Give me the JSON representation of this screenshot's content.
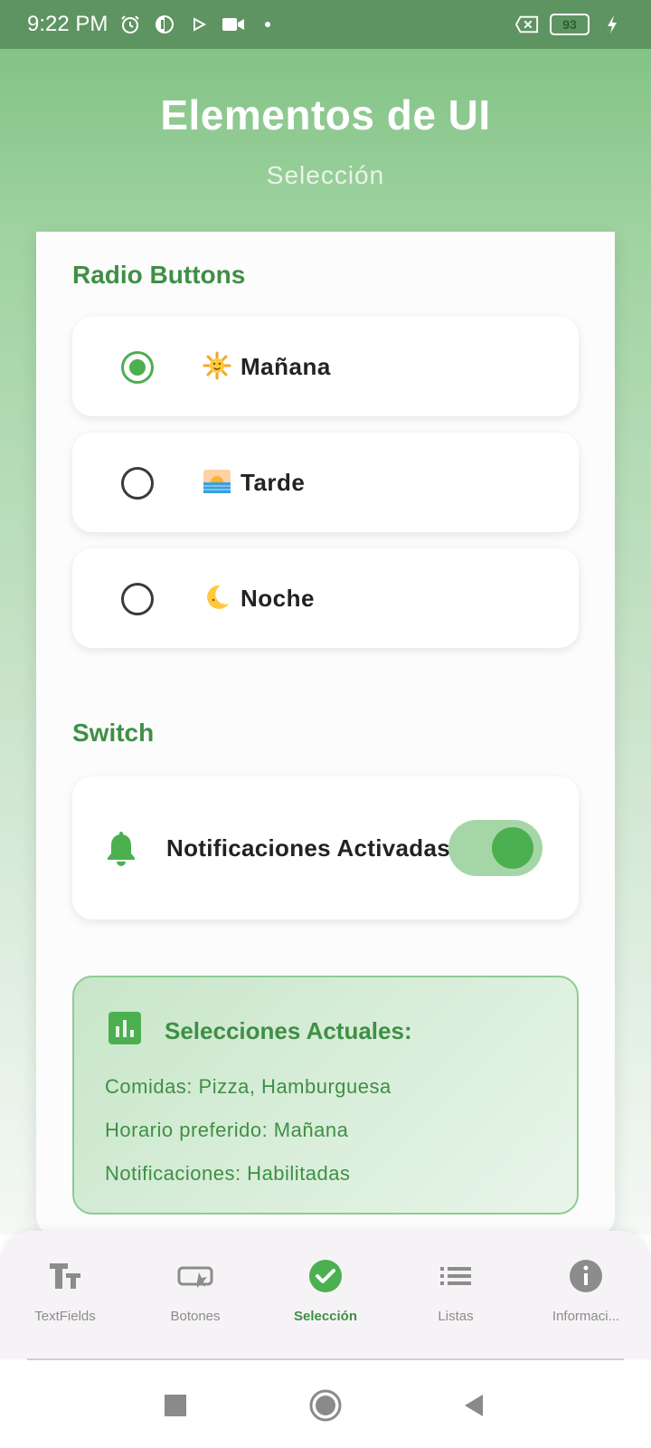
{
  "status_bar": {
    "time": "9:22 PM",
    "battery_level": "93",
    "icons": [
      "alarm-icon",
      "app-icon",
      "play-store-icon",
      "video-icon",
      "dot-icon",
      "no-sim-icon",
      "battery-icon",
      "charging-icon"
    ]
  },
  "header": {
    "title": "Elementos de UI",
    "subtitle": "Selección"
  },
  "radio_section": {
    "title": "Radio Buttons",
    "options": [
      {
        "label": "Mañana",
        "selected": true,
        "icon": "sun-icon"
      },
      {
        "label": "Tarde",
        "selected": false,
        "icon": "sunrise-icon"
      },
      {
        "label": "Noche",
        "selected": false,
        "icon": "crescent-moon-icon"
      }
    ]
  },
  "switch_section": {
    "title": "Switch",
    "label": "Notificaciones Activadas",
    "on": true
  },
  "summary": {
    "title": "Selecciones Actuales:",
    "lines": [
      "Comidas: Pizza, Hamburguesa",
      "Horario preferido: Mañana",
      "Notificaciones: Habilitadas"
    ]
  },
  "bottom_nav": {
    "items": [
      {
        "label": "TextFields",
        "icon": "text-fields-icon",
        "active": false
      },
      {
        "label": "Botones",
        "icon": "button-icon",
        "active": false
      },
      {
        "label": "Selección",
        "icon": "check-circle-icon",
        "active": true
      },
      {
        "label": "Listas",
        "icon": "list-icon",
        "active": false
      },
      {
        "label": "Informaci...",
        "icon": "info-icon",
        "active": false
      }
    ]
  },
  "colors": {
    "accent": "#4caf50",
    "accent_dark": "#3f8f45",
    "header_bg": "#83c386",
    "status_bar_bg": "#5e9461"
  }
}
